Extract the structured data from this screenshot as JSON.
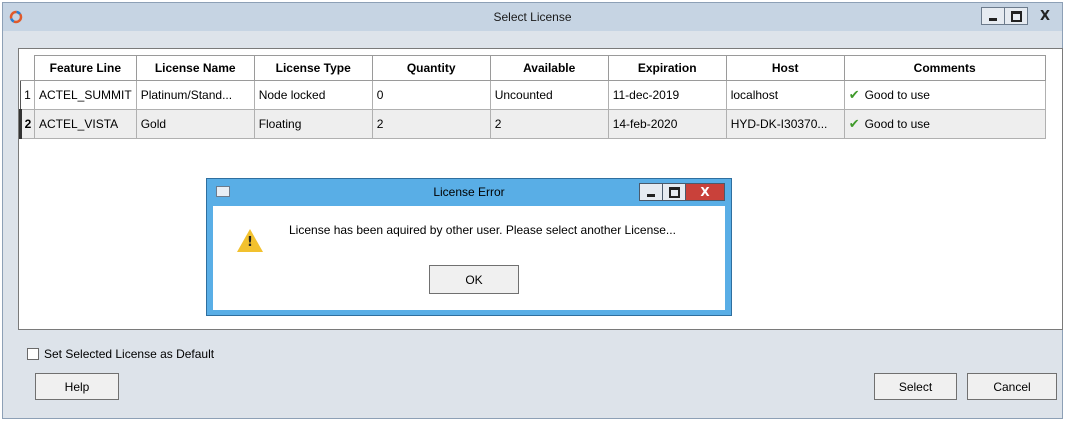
{
  "window": {
    "title": "Select License",
    "controls": {
      "minimize": "–",
      "maximize": "□",
      "close": "X"
    }
  },
  "table": {
    "columns": [
      "Feature Line",
      "License Name",
      "License Type",
      "Quantity",
      "Available",
      "Expiration",
      "Host",
      "Comments"
    ],
    "rows": [
      {
        "num": "1",
        "cells": [
          "ACTEL_SUMMIT",
          "Platinum/Stand...",
          "Node locked",
          "0",
          "Uncounted",
          "11-dec-2019",
          "localhost",
          "Good to use"
        ]
      },
      {
        "num": "2",
        "cells": [
          "ACTEL_VISTA",
          "Gold",
          "Floating",
          "2",
          "2",
          "14-feb-2020",
          "HYD-DK-I30370...",
          "Good to use"
        ]
      }
    ],
    "comment_icon": "green-checkmark-icon"
  },
  "dialog": {
    "title": "License Error",
    "message": "License has been aquired by other user. Please select another License...",
    "ok_label": "OK",
    "icon": "warning-icon",
    "close_color": "#c9413a",
    "frame_color": "#59aee6"
  },
  "footer": {
    "default_checkbox_label": "Set Selected License as Default",
    "help_label": "Help",
    "select_label": "Select",
    "cancel_label": "Cancel"
  }
}
